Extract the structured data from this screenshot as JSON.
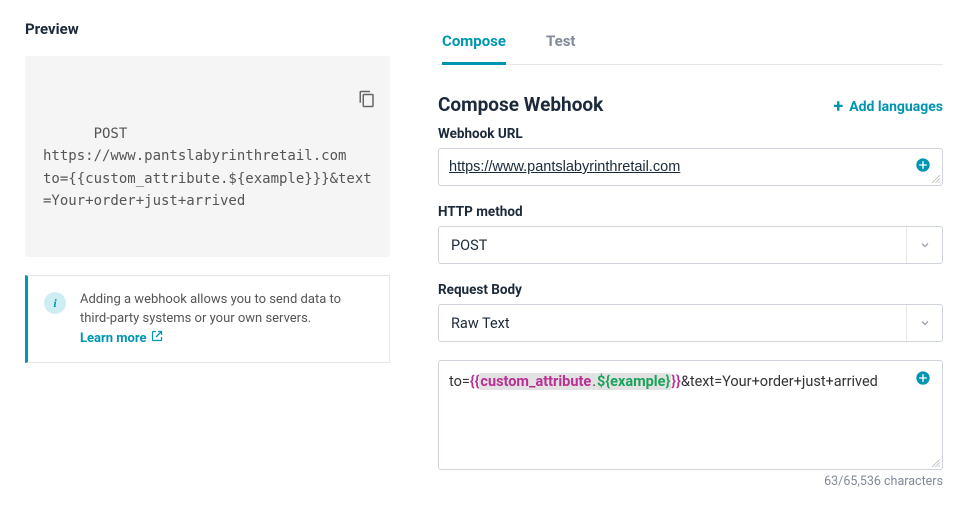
{
  "preview": {
    "title": "Preview",
    "content": "POST\nhttps://www.pantslabyrinthretail.com\nto={{custom_attribute.${example}}}&text=Your+order+just+arrived"
  },
  "info": {
    "text": "Adding a webhook allows you to send data to third-party systems or your own servers. ",
    "learn_more": "Learn more"
  },
  "tabs": {
    "compose": "Compose",
    "test": "Test"
  },
  "compose": {
    "title": "Compose Webhook",
    "add_languages": "Add languages",
    "url_label": "Webhook URL",
    "url_value": "https://www.pantslabyrinthretail.com",
    "method_label": "HTTP method",
    "method_value": "POST",
    "body_label": "Request Body",
    "body_type": "Raw Text",
    "body_prefix": "to=",
    "body_open_braces": "{{",
    "body_attr": "custom_attribute",
    "body_dot": ".",
    "body_expr": "${example}",
    "body_close_braces": "}}",
    "body_suffix": "&text=Your+order+just+arrived",
    "char_count": "63/65,536 characters"
  }
}
